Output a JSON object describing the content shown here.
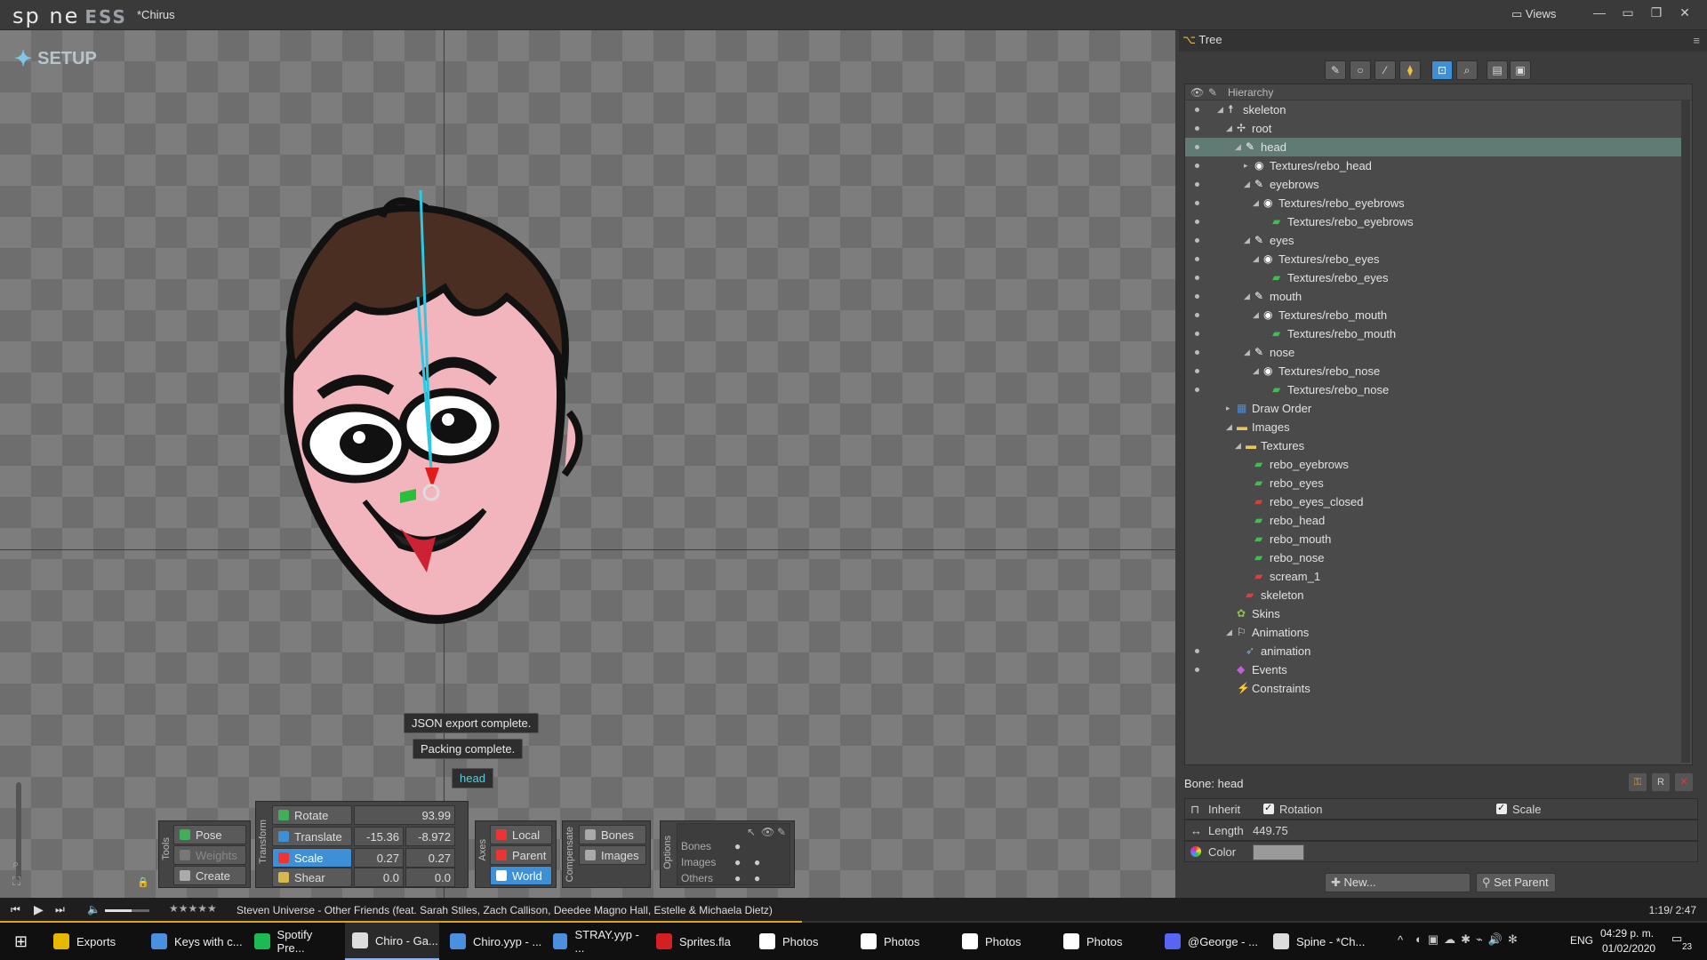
{
  "app": {
    "logo": "sp ne",
    "edition": "ESS",
    "document": "*Chirus",
    "views_label": "Views",
    "mode_label": "SETUP"
  },
  "colors": {
    "accent": "#3d8fd6",
    "selection": "#5f7b74",
    "bone_cyan": "#2ec9e0"
  },
  "viewport": {
    "toasts": [
      "JSON export complete.",
      "Packing complete."
    ],
    "bone_label": "head"
  },
  "tools": {
    "label": "Tools",
    "pose": "Pose",
    "weights": "Weights",
    "create": "Create"
  },
  "transform": {
    "label": "Transform",
    "rotate": {
      "label": "Rotate",
      "value": "93.99"
    },
    "translate": {
      "label": "Translate",
      "x": "-15.36",
      "y": "-8.972"
    },
    "scale": {
      "label": "Scale",
      "x": "0.27",
      "y": "0.27"
    },
    "shear": {
      "label": "Shear",
      "x": "0.0",
      "y": "0.0"
    }
  },
  "axes": {
    "label": "Axes",
    "local": "Local",
    "parent": "Parent",
    "world": "World"
  },
  "compensate": {
    "label": "Compensate",
    "bones": "Bones",
    "images": "Images"
  },
  "options": {
    "label": "Options",
    "bones": "Bones",
    "images": "Images",
    "others": "Others"
  },
  "panel": {
    "tab": "Tree",
    "hierarchy_header": "Hierarchy"
  },
  "tree": [
    {
      "label": "skeleton",
      "depth": 0,
      "icon": "skeleton-icon",
      "dot": true
    },
    {
      "label": "root",
      "depth": 1,
      "icon": "root-bone-icon",
      "dot": true
    },
    {
      "label": "head",
      "depth": 2,
      "icon": "bone-icon",
      "dot": true,
      "selected": true
    },
    {
      "label": "Textures/rebo_head",
      "depth": 3,
      "icon": "slot-icon",
      "dot": true
    },
    {
      "label": "eyebrows",
      "depth": 3,
      "icon": "bone-icon",
      "dot": true
    },
    {
      "label": "Textures/rebo_eyebrows",
      "depth": 4,
      "icon": "slot-icon",
      "dot": true
    },
    {
      "label": "Textures/rebo_eyebrows",
      "depth": 5,
      "icon": "image-icon",
      "dot": true
    },
    {
      "label": "eyes",
      "depth": 3,
      "icon": "bone-icon",
      "dot": true
    },
    {
      "label": "Textures/rebo_eyes",
      "depth": 4,
      "icon": "slot-icon",
      "dot": true
    },
    {
      "label": "Textures/rebo_eyes",
      "depth": 5,
      "icon": "image-icon",
      "dot": true
    },
    {
      "label": "mouth",
      "depth": 3,
      "icon": "bone-icon",
      "dot": true
    },
    {
      "label": "Textures/rebo_mouth",
      "depth": 4,
      "icon": "slot-icon",
      "dot": true
    },
    {
      "label": "Textures/rebo_mouth",
      "depth": 5,
      "icon": "image-icon",
      "dot": true
    },
    {
      "label": "nose",
      "depth": 3,
      "icon": "bone-icon",
      "dot": true
    },
    {
      "label": "Textures/rebo_nose",
      "depth": 4,
      "icon": "slot-icon",
      "dot": true
    },
    {
      "label": "Textures/rebo_nose",
      "depth": 5,
      "icon": "image-icon",
      "dot": true
    },
    {
      "label": "Draw Order",
      "depth": 1,
      "icon": "draw-order-icon",
      "dot": false
    },
    {
      "label": "Images",
      "depth": 1,
      "icon": "folder-icon",
      "dot": false
    },
    {
      "label": "Textures",
      "depth": 2,
      "icon": "folder-icon",
      "dot": false
    },
    {
      "label": "rebo_eyebrows",
      "depth": 3,
      "icon": "image-icon",
      "dot": false
    },
    {
      "label": "rebo_eyes",
      "depth": 3,
      "icon": "image-icon",
      "dot": false
    },
    {
      "label": "rebo_eyes_closed",
      "depth": 3,
      "icon": "image-unused-icon",
      "dot": false
    },
    {
      "label": "rebo_head",
      "depth": 3,
      "icon": "image-icon",
      "dot": false
    },
    {
      "label": "rebo_mouth",
      "depth": 3,
      "icon": "image-icon",
      "dot": false
    },
    {
      "label": "rebo_nose",
      "depth": 3,
      "icon": "image-icon",
      "dot": false
    },
    {
      "label": "scream_1",
      "depth": 3,
      "icon": "image-unused-icon",
      "dot": false
    },
    {
      "label": "skeleton",
      "depth": 2,
      "icon": "image-unused-icon",
      "dot": false
    },
    {
      "label": "Skins",
      "depth": 1,
      "icon": "skins-icon",
      "dot": false
    },
    {
      "label": "Animations",
      "depth": 1,
      "icon": "animations-icon",
      "dot": false
    },
    {
      "label": "animation",
      "depth": 2,
      "icon": "animation-icon",
      "dot": true
    },
    {
      "label": "Events",
      "depth": 1,
      "icon": "events-icon",
      "dot": true
    },
    {
      "label": "Constraints",
      "depth": 1,
      "icon": "constraints-icon",
      "dot": false
    }
  ],
  "bone_props": {
    "title": "Bone: head",
    "inherit": "Inherit",
    "rotation": "Rotation",
    "scale": "Scale",
    "length_label": "Length",
    "length": "449.75",
    "color_label": "Color",
    "new_btn": "New...",
    "set_parent_btn": "Set Parent"
  },
  "media": {
    "track": "Steven Universe - Other Friends (feat. Sarah Stiles, Zach Callison, Deedee Magno Hall, Estelle & Michaela Dietz)",
    "time": "1:19/ 2:47",
    "progress": 0.47
  },
  "taskbar": {
    "items": [
      "Exports",
      "Keys with c...",
      "Spotify Pre...",
      "Chiro - Ga...",
      "Chiro.yyp - ...",
      "STRAY.yyp - ...",
      "Sprites.fla",
      "Photos",
      "Photos",
      "Photos",
      "Photos",
      "@George - ...",
      "Spine - *Ch..."
    ],
    "lang": "ENG",
    "time": "04:29 p. m.",
    "date": "01/02/2020",
    "notif": "23"
  }
}
